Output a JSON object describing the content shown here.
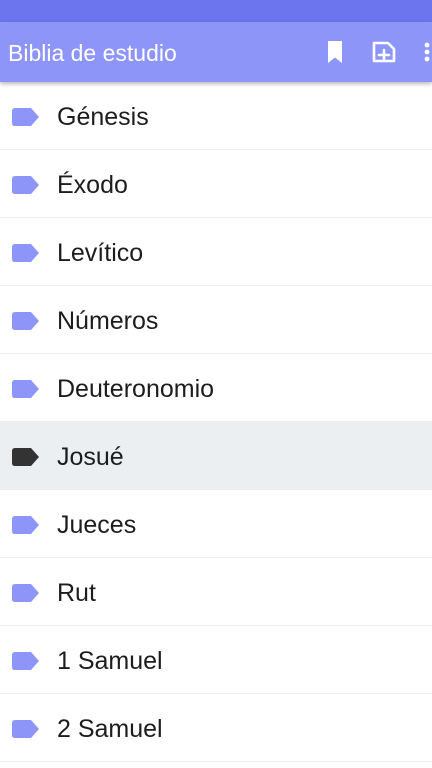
{
  "status_bar": {
    "color": "#6c74ee"
  },
  "app_bar": {
    "title": "Biblia de estudio",
    "color": "#8d96f8",
    "actions": [
      {
        "icon": "bookmark-icon"
      },
      {
        "icon": "add-document-icon"
      },
      {
        "icon": "more-vert-icon"
      }
    ]
  },
  "colors": {
    "label_icon": "#8d96f8",
    "label_icon_selected": "#333333",
    "selected_row_bg": "#eceff2"
  },
  "books": [
    {
      "name": "Génesis",
      "selected": false
    },
    {
      "name": "Éxodo",
      "selected": false
    },
    {
      "name": "Levítico",
      "selected": false
    },
    {
      "name": "Números",
      "selected": false
    },
    {
      "name": "Deuteronomio",
      "selected": false
    },
    {
      "name": "Josué",
      "selected": true
    },
    {
      "name": "Jueces",
      "selected": false
    },
    {
      "name": "Rut",
      "selected": false
    },
    {
      "name": "1 Samuel",
      "selected": false
    },
    {
      "name": "2 Samuel",
      "selected": false
    }
  ]
}
